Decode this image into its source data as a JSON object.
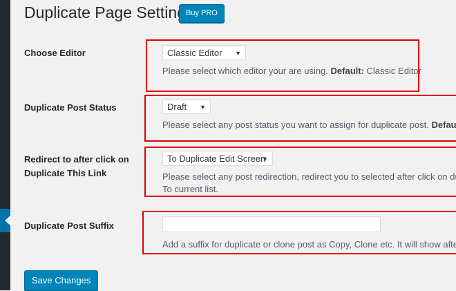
{
  "page": {
    "title": "Duplicate Page Settings",
    "buy_pro_label": "Buy PRO"
  },
  "settings": {
    "editor": {
      "label": "Choose Editor",
      "selected": "Classic Editor",
      "desc_text": "Please select which editor your are using. ",
      "desc_default_label": "Default:",
      "desc_default_value": " Classic Editor"
    },
    "status": {
      "label": "Duplicate Post Status",
      "selected": "Draft",
      "desc_text": "Please select any post status you want to assign for duplicate post. ",
      "desc_default_label": "Default:",
      "desc_default_value": " D"
    },
    "redirect": {
      "label": "Redirect to after click on Duplicate This Link",
      "selected": "To Duplicate Edit Screen",
      "desc_line1": "Please select any post redirection, redirect you to selected after click on dupl",
      "desc_line2": "To current list."
    },
    "suffix": {
      "label": "Duplicate Post Suffix",
      "value": "",
      "desc": "Add a suffix for duplicate or clone post as Copy, Clone etc. It will show after t"
    }
  },
  "footer": {
    "save_label": "Save Changes"
  },
  "colors": {
    "primary": "#0085ba",
    "highlight_box": "#e00000",
    "sidebar": "#23282d",
    "background": "#f1f1f1"
  }
}
